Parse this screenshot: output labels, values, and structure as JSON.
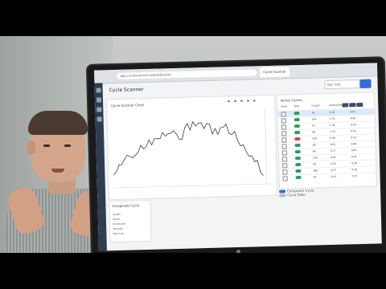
{
  "app": {
    "title": "Cycle Scanner",
    "url": "app.cyclescanner.example/scan",
    "tabs": [
      "Cycle Scanner"
    ]
  },
  "search": {
    "value": "S&P 500"
  },
  "chart": {
    "title": "Cycle Scanner Chart"
  },
  "cycles": {
    "title": "Active Cycles",
    "columns": [
      "Show",
      "Type",
      "Length",
      "Amplitude",
      "Strength"
    ],
    "rows": [
      {
        "length": "76",
        "amp": "2.10",
        "str": "0.67"
      },
      {
        "length": "144",
        "amp": "1.74",
        "str": "0.62"
      },
      {
        "length": "52",
        "amp": "1.36",
        "str": "0.59"
      },
      {
        "length": "98",
        "amp": "1.12",
        "str": "0.55"
      },
      {
        "length": "210",
        "amp": "0.98",
        "str": "0.52"
      },
      {
        "length": "38",
        "amp": "0.81",
        "str": "0.48"
      },
      {
        "length": "64",
        "amp": "0.77",
        "str": "0.45"
      },
      {
        "length": "120",
        "amp": "0.64",
        "str": "0.41"
      },
      {
        "length": "28",
        "amp": "0.52",
        "str": "0.38"
      },
      {
        "length": "180",
        "amp": "0.47",
        "str": "0.36"
      },
      {
        "length": "44",
        "amp": "0.41",
        "str": "0.33"
      }
    ],
    "footer": [
      "Composite Cycle",
      "Cycle Table"
    ]
  },
  "stats": {
    "title": "Composite Cycle",
    "labels": [
      "Length",
      "Phase",
      "Amplitude",
      "Strength",
      "Next Low"
    ]
  },
  "colors": {
    "accent": "#2f6fd6",
    "sidebar": "#2c3e50",
    "line": "#222222"
  }
}
